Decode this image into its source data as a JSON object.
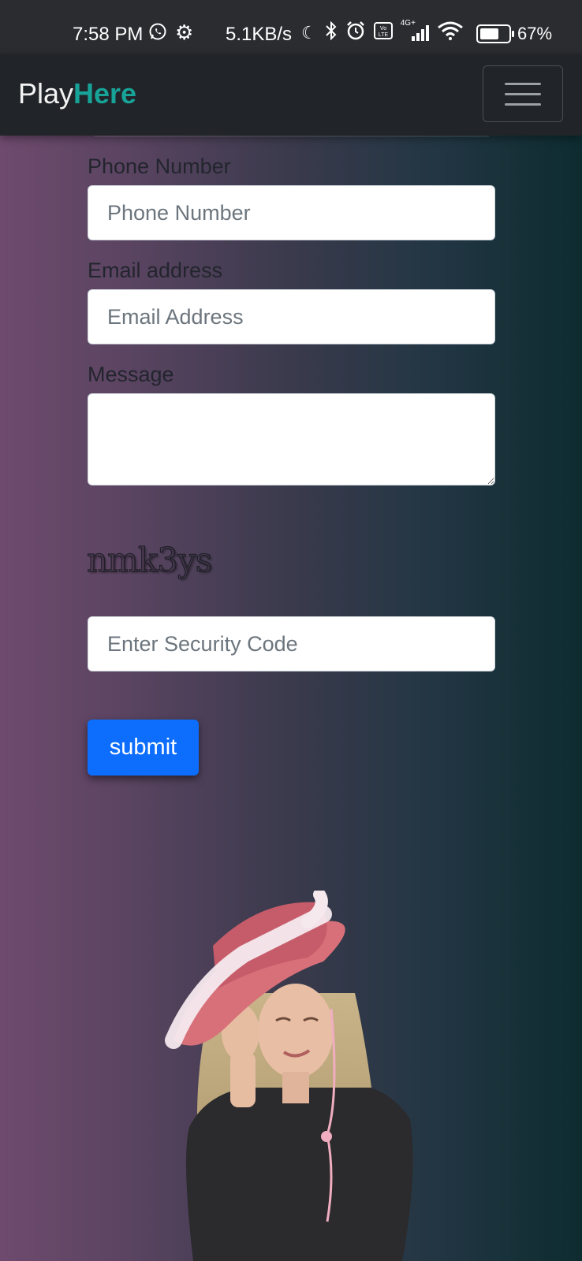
{
  "status_bar": {
    "time": "7:58 PM",
    "network_speed": "5.1KB/s",
    "network_type": "4G+",
    "battery_level": 0.67,
    "battery_text": "67%",
    "icons": [
      "whatsapp-icon",
      "gear-icon",
      "moon-icon",
      "bluetooth-icon",
      "alarm-icon",
      "volte-icon",
      "signal-icon",
      "wifi-icon",
      "battery-icon"
    ]
  },
  "navbar": {
    "brand_part1": "Play",
    "brand_part2": "Here",
    "brand_accent_color": "#17a398",
    "menu_icon": "hamburger-icon"
  },
  "form": {
    "phone": {
      "label": "Phone Number",
      "placeholder": "Phone Number",
      "value": ""
    },
    "email": {
      "label": "Email address",
      "placeholder": "Email Address",
      "value": ""
    },
    "message": {
      "label": "Message",
      "value": ""
    },
    "captcha_text": "nmk3ys",
    "security": {
      "placeholder": "Enter Security Code",
      "value": ""
    },
    "submit_label": "submit",
    "submit_color": "#0d6efd"
  }
}
